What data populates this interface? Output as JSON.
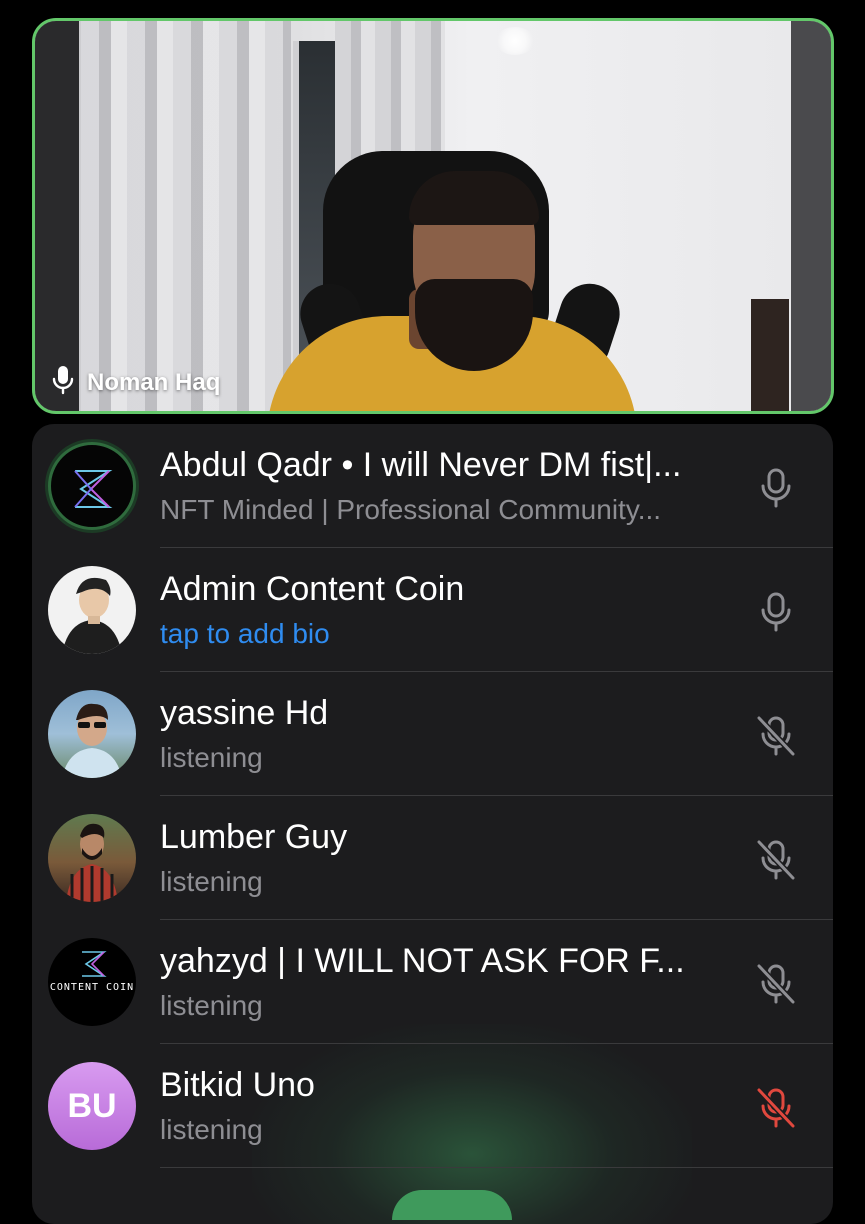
{
  "speaker": {
    "name": "Noman Haq",
    "mic_icon": "microphone-icon"
  },
  "participants": [
    {
      "name": "Abdul Qadr • I will Never DM fist|...",
      "status": "NFT Minded | Professional Community...",
      "avatar": "logo-avatar",
      "mic_state": "active",
      "mic_icon": "microphone-icon"
    },
    {
      "name": "Admin Content Coin",
      "status": "tap to add bio",
      "avatar": "cartoon-avatar",
      "mic_state": "active",
      "mic_icon": "microphone-icon"
    },
    {
      "name": "yassine Hd",
      "status": "listening",
      "avatar": "photo-avatar",
      "mic_state": "muted",
      "mic_icon": "microphone-muted-icon"
    },
    {
      "name": "Lumber Guy",
      "status": "listening",
      "avatar": "photo-avatar",
      "mic_state": "muted",
      "mic_icon": "microphone-muted-icon"
    },
    {
      "name": "yahzyd | I WILL NOT ASK FOR F...",
      "status": "listening",
      "avatar": "content-coin-avatar",
      "avatar_text": "CONTENT COIN",
      "mic_state": "muted",
      "mic_icon": "microphone-muted-icon"
    },
    {
      "name": "Bitkid Uno",
      "status": "listening",
      "avatar": "initials-avatar",
      "avatar_initials": "BU",
      "mic_state": "muted-by-admin",
      "mic_icon": "microphone-muted-icon"
    }
  ],
  "colors": {
    "active_speaker_border": "#63c76a",
    "panel_background": "#1c1c1e",
    "secondary_text": "#8e8e93",
    "link_blue": "#2f8cf0",
    "mic_grey": "#8e8e93",
    "mic_muted_red": "#e0483e"
  }
}
